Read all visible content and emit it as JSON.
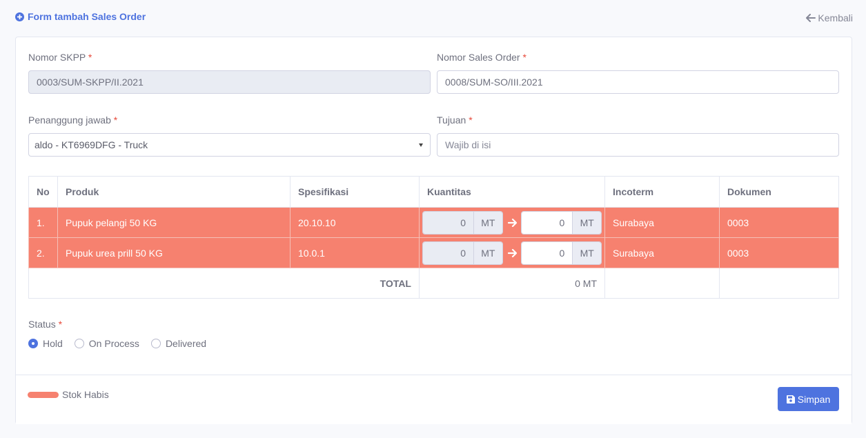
{
  "header": {
    "title": "Form tambah Sales Order",
    "back_label": "Kembali"
  },
  "form": {
    "nomor_skpp": {
      "label": "Nomor SKPP",
      "value": "0003/SUM-SKPP/II.2021"
    },
    "nomor_so": {
      "label": "Nomor Sales Order",
      "value": "0008/SUM-SO/III.2021"
    },
    "penanggung_jawab": {
      "label": "Penanggung jawab",
      "value": "aldo - KT6969DFG - Truck"
    },
    "tujuan": {
      "label": "Tujuan",
      "value": "",
      "placeholder": "Wajib di isi"
    },
    "required_mark": "*"
  },
  "table": {
    "headers": [
      "No",
      "Produk",
      "Spesifikasi",
      "Kuantitas",
      "Incoterm",
      "Dokumen"
    ],
    "rows": [
      {
        "no": "1.",
        "produk": "Pupuk pelangi 50 KG",
        "spesifikasi": "20.10.10",
        "qty_from": "0",
        "qty_to": "0",
        "unit": "MT",
        "incoterm": "Surabaya",
        "dokumen": "0003"
      },
      {
        "no": "2.",
        "produk": "Pupuk urea prill 50 KG",
        "spesifikasi": "10.0.1",
        "qty_from": "0",
        "qty_to": "0",
        "unit": "MT",
        "incoterm": "Surabaya",
        "dokumen": "0003"
      }
    ],
    "total_label": "TOTAL",
    "total_value": "0 MT"
  },
  "status": {
    "label": "Status",
    "options": [
      "Hold",
      "On Process",
      "Delivered"
    ],
    "selected": "Hold"
  },
  "footer": {
    "legend_label": "Stok Habis",
    "legend_color": "#f6816f",
    "save_label": "Simpan"
  },
  "colors": {
    "primary": "#4e73df",
    "stok_habis": "#f6816f",
    "required": "#e74a3b"
  }
}
